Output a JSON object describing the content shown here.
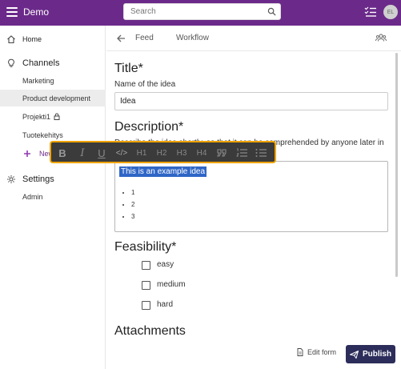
{
  "app": {
    "title": "Demo",
    "avatar_initials": "EL"
  },
  "search": {
    "placeholder": "Search"
  },
  "sidebar": {
    "home": "Home",
    "channels": "Channels",
    "channel_items": [
      "Marketing",
      "Product development",
      "Projekti1",
      "Tuotekehitys"
    ],
    "new_channel": "New channel",
    "settings": "Settings",
    "admin": "Admin"
  },
  "content_header": {
    "tabs": [
      "Feed",
      "Workflow"
    ]
  },
  "form": {
    "title_heading": "Title*",
    "title_label": "Name of the idea",
    "title_value": "Idea",
    "description_heading": "Description*",
    "description_help": "Describe the idea shortly, so that it can be comprehended by anyone later in the process.",
    "editor_selected_text": "This is an example idea",
    "editor_list": [
      "1",
      "2",
      "3"
    ],
    "feasibility_heading": "Feasibility*",
    "feasibility_options": [
      "easy",
      "medium",
      "hard"
    ],
    "attachments_heading": "Attachments"
  },
  "toolbar": {
    "bold": "B",
    "italic": "I",
    "underline": "U",
    "code": "</>",
    "h1": "H1",
    "h2": "H2",
    "h3": "H3",
    "h4": "H4"
  },
  "actions": {
    "edit_form": "Edit form",
    "publish": "Publish"
  },
  "colors": {
    "header": "#6b2a8a",
    "publish": "#2c2d5a",
    "selection": "#2f66c7",
    "toolbar_border": "#f0a400"
  }
}
